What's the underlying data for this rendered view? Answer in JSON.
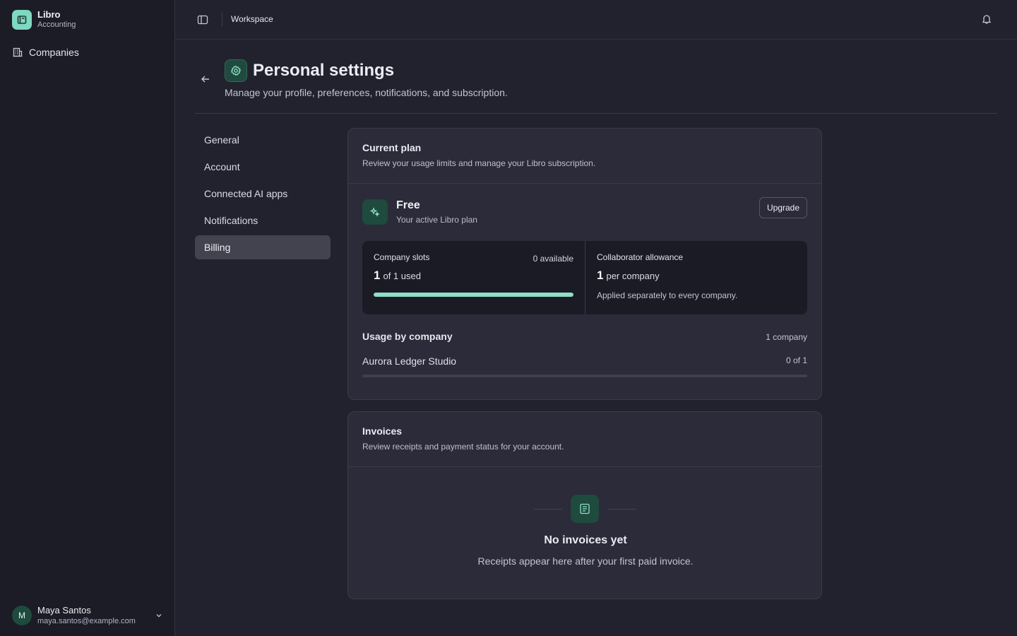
{
  "brand": {
    "name": "Libro",
    "subtitle": "Accounting"
  },
  "sidebar": {
    "nav": [
      {
        "label": "Companies",
        "icon": "building-icon"
      }
    ]
  },
  "user": {
    "initial": "M",
    "name": "Maya Santos",
    "email": "maya.santos@example.com"
  },
  "topbar": {
    "title": "Workspace"
  },
  "header": {
    "title": "Personal settings",
    "subtitle": "Manage your profile, preferences, notifications, and subscription."
  },
  "settings_nav": {
    "items": [
      "General",
      "Account",
      "Connected AI apps",
      "Notifications",
      "Billing"
    ],
    "active": "Billing"
  },
  "plan": {
    "title": "Current plan",
    "description": "Review your usage limits and manage your Libro subscription.",
    "name": "Free",
    "subtitle": "Your active Libro plan",
    "upgrade_label": "Upgrade",
    "company_slots": {
      "label": "Company slots",
      "available": "0 available",
      "used": "1",
      "of_text": "of 1 used",
      "progress": 1.0
    },
    "collaborators": {
      "label": "Collaborator allowance",
      "value": "1",
      "unit": "per company",
      "note": "Applied separately to every company."
    },
    "usage": {
      "title": "Usage by company",
      "count": "1 company",
      "rows": [
        {
          "name": "Aurora Ledger Studio",
          "value": "0 of 1",
          "progress": 0
        }
      ]
    }
  },
  "invoices": {
    "title": "Invoices",
    "description": "Review receipts and payment status for your account.",
    "empty_title": "No invoices yet",
    "empty_desc": "Receipts appear here after your first paid invoice."
  },
  "colors": {
    "accent": "#8fe0c8",
    "accent_dark": "#1f4a3e",
    "background": "#22222f",
    "sidebar": "#1c1c27"
  }
}
